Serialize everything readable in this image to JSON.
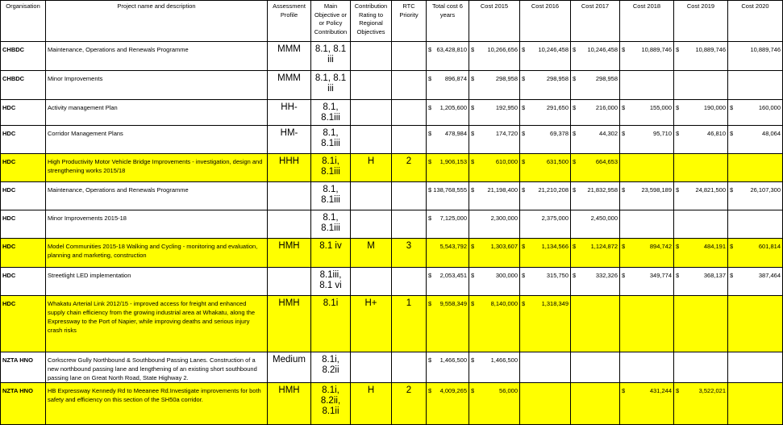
{
  "headers": [
    "Organisation",
    "Project name and description",
    "Assessment Profile",
    "Main Objective or or Policy Contribution",
    "Contribution Rating to Regional Objectives",
    "RTC Priority",
    "Total cost 6 years",
    "Cost 2015",
    "Cost 2016",
    "Cost 2017",
    "Cost 2018",
    "Cost 2019",
    "Cost 2020"
  ],
  "currency_symbol": "$",
  "highlight_color": "#ffff00",
  "rows": [
    {
      "org": "CHBDC",
      "desc": "Maintenance, Operations and Renewals Programme",
      "profile": "MMM",
      "objective": "8.1, 8.1 iii",
      "rating": "",
      "priority": "",
      "total": "63,428,810",
      "c2015": "10,266,656",
      "c2016": "10,246,458",
      "c2017": "10,246,458",
      "c2018": "10,889,746",
      "c2019": "10,889,746",
      "c2020": "10,889,746",
      "highlight": false,
      "sym": [
        true,
        true,
        true,
        true,
        true,
        true,
        false
      ]
    },
    {
      "org": "CHBDC",
      "desc": "Minor Improvements",
      "profile": "MMM",
      "objective": "8.1, 8.1 iii",
      "rating": "",
      "priority": "",
      "total": "896,874",
      "c2015": "298,958",
      "c2016": "298,958",
      "c2017": "298,958",
      "c2018": "",
      "c2019": "",
      "c2020": "",
      "highlight": false,
      "sym": [
        true,
        true,
        true,
        true,
        false,
        false,
        false
      ]
    },
    {
      "org": "HDC",
      "desc": "Activity management Plan",
      "profile": "HH-",
      "objective": "8.1, 8.1iii",
      "rating": "",
      "priority": "",
      "total": "1,205,600",
      "c2015": "192,950",
      "c2016": "291,650",
      "c2017": "216,000",
      "c2018": "155,000",
      "c2019": "190,000",
      "c2020": "160,000",
      "highlight": false,
      "sym": [
        true,
        true,
        true,
        true,
        true,
        true,
        true
      ]
    },
    {
      "org": "HDC",
      "desc": "Corridor Management Plans",
      "profile": "HM-",
      "objective": "8.1, 8.1iii",
      "rating": "",
      "priority": "",
      "total": "478,984",
      "c2015": "174,720",
      "c2016": "69,378",
      "c2017": "44,302",
      "c2018": "95,710",
      "c2019": "46,810",
      "c2020": "48,064",
      "highlight": false,
      "sym": [
        true,
        true,
        true,
        true,
        true,
        true,
        true
      ]
    },
    {
      "org": "HDC",
      "desc": "High Productivity Motor Vehicle Bridge Improvements - investigation, design and strengthening works 2015/18",
      "profile": "HHH",
      "objective": "8.1i, 8.1iii",
      "rating": "H",
      "priority": "2",
      "total": "1,906,153",
      "c2015": "610,000",
      "c2016": "631,500",
      "c2017": "664,653",
      "c2018": "",
      "c2019": "",
      "c2020": "",
      "highlight": true,
      "sym": [
        true,
        true,
        true,
        true,
        false,
        false,
        false
      ]
    },
    {
      "org": "HDC",
      "desc": "Maintenance, Operations and Renewals Programme",
      "profile": "",
      "objective": "8.1, 8.1iii",
      "rating": "",
      "priority": "",
      "total": "138,768,555",
      "c2015": "21,198,400",
      "c2016": "21,210,208",
      "c2017": "21,832,958",
      "c2018": "23,598,189",
      "c2019": "24,821,500",
      "c2020": "26,107,300",
      "highlight": false,
      "sym": [
        true,
        true,
        true,
        true,
        true,
        true,
        true
      ]
    },
    {
      "org": "HDC",
      "desc": "Minor Improvements 2015-18",
      "profile": "",
      "objective": "8.1, 8.1iii",
      "rating": "",
      "priority": "",
      "total": "7,125,000",
      "c2015": "2,300,000",
      "c2016": "2,375,000",
      "c2017": "2,450,000",
      "c2018": "",
      "c2019": "",
      "c2020": "",
      "highlight": false,
      "sym": [
        true,
        false,
        false,
        false,
        false,
        false,
        false
      ]
    },
    {
      "org": "HDC",
      "desc": "Model Communities 2015-18 Walking and Cycling - monitoring and evaluation, planning and marketing, construction",
      "profile": "HMH",
      "objective": "8.1 iv",
      "rating": "M",
      "priority": "3",
      "total": "5,543,792",
      "c2015": "1,303,607",
      "c2016": "1,134,566",
      "c2017": "1,124,872",
      "c2018": "894,742",
      "c2019": "484,191",
      "c2020": "601,814",
      "highlight": true,
      "sym": [
        false,
        true,
        true,
        true,
        true,
        true,
        true
      ]
    },
    {
      "org": "HDC",
      "desc": "Streetlight LED implementation",
      "profile": "",
      "objective": "8.1iii, 8.1 vi",
      "rating": "",
      "priority": "",
      "total": "2,053,451",
      "c2015": "300,000",
      "c2016": "315,750",
      "c2017": "332,326",
      "c2018": "349,774",
      "c2019": "368,137",
      "c2020": "387,464",
      "highlight": false,
      "sym": [
        true,
        true,
        true,
        true,
        true,
        true,
        true
      ]
    },
    {
      "org": "HDC",
      "desc": "Whakatu Arterial Link 2012/15 - improved access for freight and enhanced supply chain efficiency from the growing industrial area at Whakatu, along the Expressway to the Port of Napier, while improving deaths and serious injury crash risks",
      "profile": "HMH",
      "objective": "8.1i",
      "rating": "H+",
      "priority": "1",
      "total": "9,558,349",
      "c2015": "8,140,000",
      "c2016": "1,318,349",
      "c2017": "",
      "c2018": "",
      "c2019": "",
      "c2020": "",
      "highlight": true,
      "sym": [
        true,
        true,
        true,
        false,
        false,
        false,
        false
      ]
    },
    {
      "org": "NZTA HNO",
      "desc": "Corkscrew Gully Northbound & Southbound Passing Lanes. Construction of a new northbound passing lane and lengthening of an existing short southbound passing lane on Great North Road, State Highway 2.",
      "profile": "Medium",
      "objective": "8.1i, 8.2ii",
      "rating": "",
      "priority": "",
      "total": "1,466,500",
      "c2015": "1,466,500",
      "c2016": "",
      "c2017": "",
      "c2018": "",
      "c2019": "",
      "c2020": "",
      "highlight": false,
      "sym": [
        true,
        true,
        false,
        false,
        false,
        false,
        false
      ]
    },
    {
      "org": "NZTA HNO",
      "desc": "HB Expressway Kennedy Rd to Meeanee Rd.Investigate improvements for both safety and efficiency on this section of the SH50a corridor.",
      "profile": "HMH",
      "objective": "8.1i, 8.2ii, 8.1ii",
      "rating": "H",
      "priority": "2",
      "total": "4,009,265",
      "c2015": "56,000",
      "c2016": "",
      "c2017": "",
      "c2018": "431,244",
      "c2019": "3,522,021",
      "c2020": "",
      "highlight": true,
      "sym": [
        true,
        true,
        false,
        false,
        true,
        true,
        false
      ]
    }
  ]
}
